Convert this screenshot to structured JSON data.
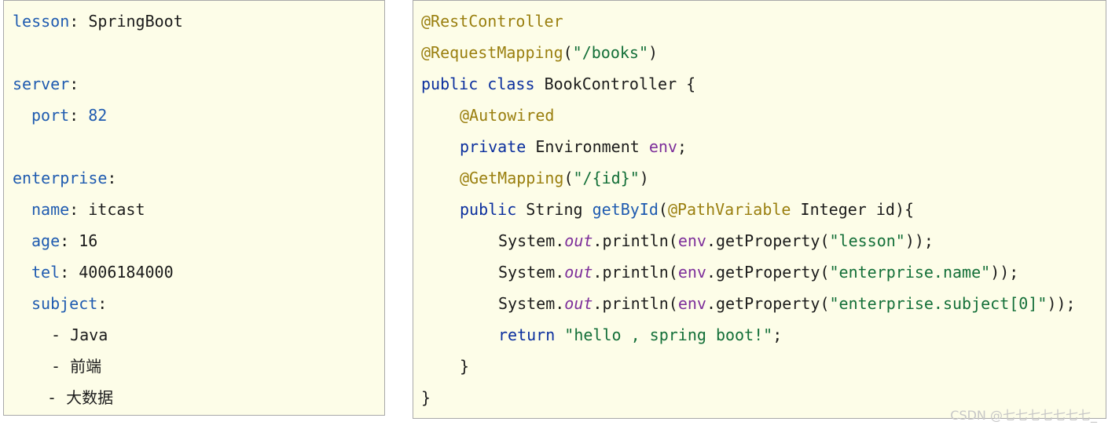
{
  "yaml": {
    "lesson_key": "lesson",
    "lesson_value": "SpringBoot",
    "server_key": "server",
    "port_key": "port",
    "port_value": "82",
    "enterprise_key": "enterprise",
    "name_key": "name",
    "name_value": "itcast",
    "age_key": "age",
    "age_value": "16",
    "tel_key": "tel",
    "tel_value": "4006184000",
    "subject_key": "subject",
    "subjects": [
      "Java",
      "前端",
      "大数据"
    ]
  },
  "java": {
    "annotation_controller": "@RestController",
    "annotation_mapping": "@RequestMapping",
    "mapping_path": "\"/books\"",
    "kw_public": "public",
    "kw_class": "class",
    "class_name": "BookController",
    "annotation_autowired": "@Autowired",
    "kw_private": "private",
    "type_environment": "Environment",
    "field_env": "env",
    "annotation_get": "@GetMapping",
    "get_path": "\"/{id}\"",
    "type_string": "String",
    "method_name": "getById",
    "annotation_path_variable": "@PathVariable",
    "param_type": "Integer",
    "param_name": "id",
    "system": "System",
    "out": "out",
    "println": "println",
    "get_property": "getProperty",
    "prop_lesson": "\"lesson\"",
    "prop_name": "\"enterprise.name\"",
    "prop_subject": "\"enterprise.subject[0]\"",
    "kw_return": "return",
    "return_value": "\"hello , spring boot!\""
  },
  "watermark": "CSDN @七七七七七七七_"
}
